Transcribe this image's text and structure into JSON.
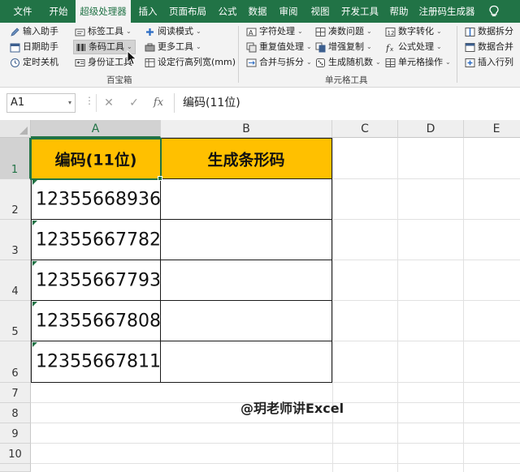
{
  "ribbon_tabs": [
    "文件",
    "开始",
    "超级处理器",
    "插入",
    "页面布局",
    "公式",
    "数据",
    "审阅",
    "视图",
    "开发工具",
    "帮助",
    "注册码生成器"
  ],
  "active_tab": "超级处理器",
  "icons": {
    "tip": "lightbulb-icon"
  },
  "ribbon": {
    "g1": {
      "input_helper": "输入助手",
      "date_helper": "日期助手",
      "timer_shutdown": "定时关机",
      "label_tool": "标签工具",
      "barcode_tool": "条码工具",
      "id_tool": "身份证工具",
      "read_mode": "阅读模式",
      "more_tools": "更多工具",
      "set_size": "设定行高列宽(mm)",
      "group_label": "百宝箱"
    },
    "g2": {
      "char_process": "字符处理",
      "dup_process": "重复值处理",
      "merge_split": "合并与拆分",
      "round_issue": "凑数问题",
      "enhanced_copy": "增强复制",
      "random_gen": "生成随机数",
      "num_convert": "数字转化",
      "formula_process": "公式处理",
      "cell_ops": "单元格操作",
      "group_label": "单元格工具"
    },
    "g3": {
      "data_split": "数据拆分",
      "data_merge": "数据合并",
      "insert_rows": "插入行列"
    }
  },
  "name_box": "A1",
  "formula_bar": {
    "cancel": "✕",
    "confirm": "✓",
    "fx": "fx",
    "value": "编码(11位)"
  },
  "columns": [
    "A",
    "B",
    "C",
    "D",
    "E"
  ],
  "rows": [
    "1",
    "2",
    "3",
    "4",
    "5",
    "6",
    "7",
    "8",
    "9",
    "10"
  ],
  "table": {
    "headers": [
      "编码(11位)",
      "生成条形码"
    ],
    "codes": [
      "12355668936",
      "12355667782",
      "12355667793",
      "12355667808",
      "12355667811"
    ]
  },
  "watermark": "@玥老师讲Excel",
  "colors": {
    "excel_green": "#217346",
    "header_fill": "#ffc000"
  }
}
